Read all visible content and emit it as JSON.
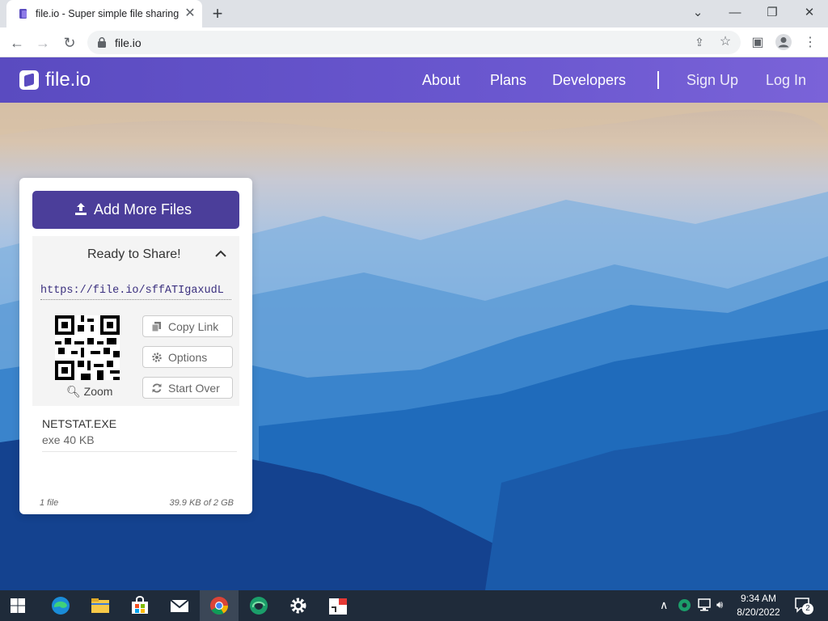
{
  "browser": {
    "tab_title": "file.io - Super simple file sharing",
    "tab_close": "✕",
    "new_tab": "+",
    "url": "file.io"
  },
  "site": {
    "logo_text": "file.io",
    "nav": [
      "About",
      "Plans",
      "Developers",
      "Sign Up",
      "Log In"
    ]
  },
  "panel": {
    "add_button": "Add More Files",
    "share_title": "Ready to Share!",
    "share_url": "https://file.io/sffATIgaxudL",
    "zoom": "Zoom",
    "copy_link": "Copy Link",
    "options": "Options",
    "start_over": "Start Over",
    "file_name": "NETSTAT.EXE",
    "file_meta": "exe 40 KB",
    "file_count": "1 file",
    "usage": "39.9 KB of 2 GB"
  },
  "taskbar": {
    "time": "9:34 AM",
    "date": "8/20/2022",
    "notifications": "2"
  },
  "colors": {
    "header": "#5a4bc0",
    "button": "#4b3e9a",
    "taskbar": "#1f2b3a"
  }
}
